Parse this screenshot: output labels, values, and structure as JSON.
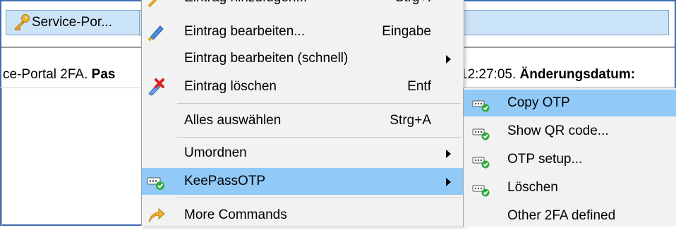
{
  "entry_row": {
    "title": "Service-Por..."
  },
  "details": {
    "left_text": "ce-Portal 2FA.",
    "left_bold": "Pas",
    "right_text": "12:27:05.",
    "right_bold": "Änderungsdatum:"
  },
  "context_menu": {
    "items": [
      {
        "label": "Eintrag hinzufügen...",
        "shortcut": "Strg+I"
      },
      {
        "label": "Eintrag bearbeiten...",
        "shortcut": "Eingabe",
        "icon": "pencil-icon"
      },
      {
        "label": "Eintrag bearbeiten (schnell)",
        "shortcut": "",
        "submenu": true
      },
      {
        "label": "Eintrag löschen",
        "shortcut": "Entf",
        "icon": "delete-icon"
      },
      {
        "label": "Alles auswählen",
        "shortcut": "Strg+A"
      },
      {
        "label": "Umordnen",
        "shortcut": "",
        "submenu": true
      },
      {
        "label": "KeePassOTP",
        "shortcut": "",
        "submenu": true,
        "icon": "otp-icon",
        "highlighted": true
      },
      {
        "label": "More Commands",
        "shortcut": "",
        "icon": "arrow-icon"
      }
    ]
  },
  "otp_submenu": {
    "items": [
      {
        "label": "Copy OTP",
        "icon": "otp-icon",
        "highlighted": true
      },
      {
        "label": "Show QR code...",
        "icon": "otp-icon"
      },
      {
        "label": "OTP setup...",
        "icon": "otp-icon"
      },
      {
        "label": "Löschen",
        "icon": "otp-icon"
      },
      {
        "label": "Other 2FA defined",
        "icon": ""
      }
    ]
  },
  "colors": {
    "frame": "#3d6cb3",
    "selection": "#cce4f7",
    "menu_bg": "#f2f2f2",
    "highlight": "#91c9f7"
  }
}
